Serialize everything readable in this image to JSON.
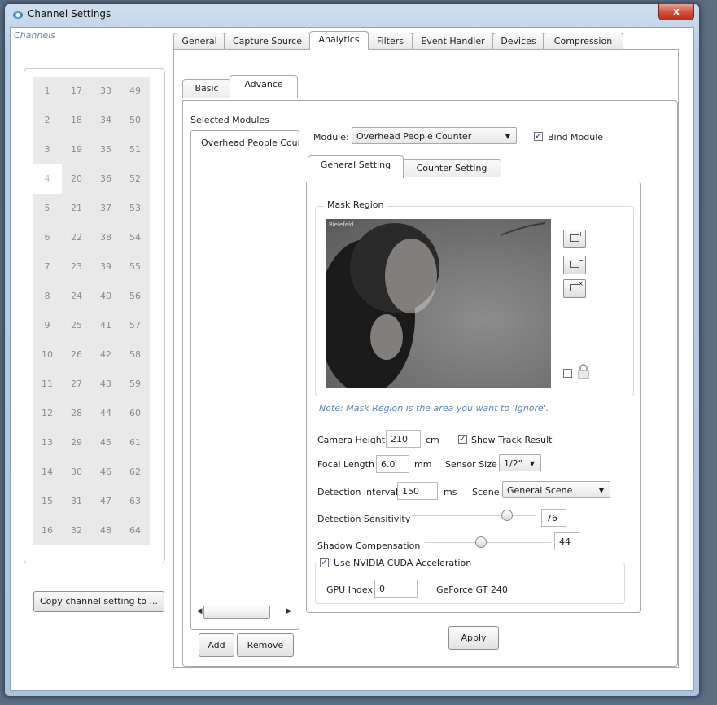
{
  "window": {
    "title": "Channel Settings",
    "close_glyph": "x"
  },
  "channels": {
    "label": "Channels",
    "columns": [
      [
        "1",
        "2",
        "3",
        "4",
        "5",
        "6",
        "7",
        "8",
        "9",
        "10",
        "11",
        "12",
        "13",
        "14",
        "15",
        "16"
      ],
      [
        "17",
        "18",
        "19",
        "20",
        "21",
        "22",
        "23",
        "24",
        "25",
        "26",
        "27",
        "28",
        "29",
        "30",
        "31",
        "32"
      ],
      [
        "33",
        "34",
        "35",
        "36",
        "37",
        "38",
        "39",
        "40",
        "41",
        "42",
        "43",
        "44",
        "45",
        "46",
        "47",
        "48"
      ],
      [
        "49",
        "50",
        "51",
        "52",
        "53",
        "54",
        "55",
        "56",
        "57",
        "58",
        "59",
        "60",
        "61",
        "62",
        "63",
        "64"
      ]
    ],
    "selected": "4",
    "copy_button": "Copy channel setting to ..."
  },
  "tabs": [
    "General",
    "Capture Source",
    "Analytics",
    "Filters",
    "Event Handler",
    "Devices",
    "Compression"
  ],
  "active_tab": "Analytics",
  "subtabs": [
    "Basic",
    "Advance"
  ],
  "active_subtab": "Advance",
  "modules": {
    "heading": "Selected Modules",
    "items": [
      "Overhead People Counter"
    ],
    "add_button": "Add",
    "remove_button": "Remove",
    "scroll_left": "◀",
    "scroll_right": "▶"
  },
  "module_select": {
    "label": "Module:",
    "value": "Overhead People Counter",
    "bind_label": "Bind Module",
    "bind_checked": true
  },
  "inner_tabs": [
    "General Setting",
    "Counter Setting"
  ],
  "active_inner_tab": "General Setting",
  "mask": {
    "group_label": "Mask Region",
    "camera_overlay_text": "Bielefeld",
    "tools": [
      {
        "icon": "mask-add-icon",
        "sym": "+"
      },
      {
        "icon": "mask-remove-icon",
        "sym": "−"
      },
      {
        "icon": "mask-clear-icon",
        "sym": "×"
      }
    ],
    "lock_checked": false,
    "note": "Note: Mask Region is the area you want to 'Ignore'."
  },
  "settings": {
    "camera_height_label": "Camera Height",
    "camera_height": "210",
    "camera_height_unit": "cm",
    "show_track_label": "Show Track Result",
    "show_track_checked": true,
    "focal_length_label": "Focal Length",
    "focal_length": "6.0",
    "focal_length_unit": "mm",
    "sensor_size_label": "Sensor Size",
    "sensor_size": "1/2\"",
    "detection_interval_label": "Detection Interval",
    "detection_interval": "150",
    "detection_interval_unit": "ms",
    "scene_label": "Scene",
    "scene": "General Scene",
    "sensitivity_label": "Detection Sensitivity",
    "sensitivity": "76",
    "sensitivity_fraction": 0.76,
    "shadow_label": "Shadow Compensation",
    "shadow": "44",
    "shadow_fraction": 0.44,
    "cuda_label": "Use NVIDIA CUDA Acceleration",
    "cuda_checked": true,
    "gpu_index_label": "GPU Index",
    "gpu_index": "0",
    "gpu_name": "GeForce GT 240"
  },
  "apply_button": "Apply",
  "colors": {
    "title_bar": "#b6cde6",
    "close_button": "#c9361f",
    "note_text": "#5b83c2",
    "check_accent": "#1f4da0"
  }
}
